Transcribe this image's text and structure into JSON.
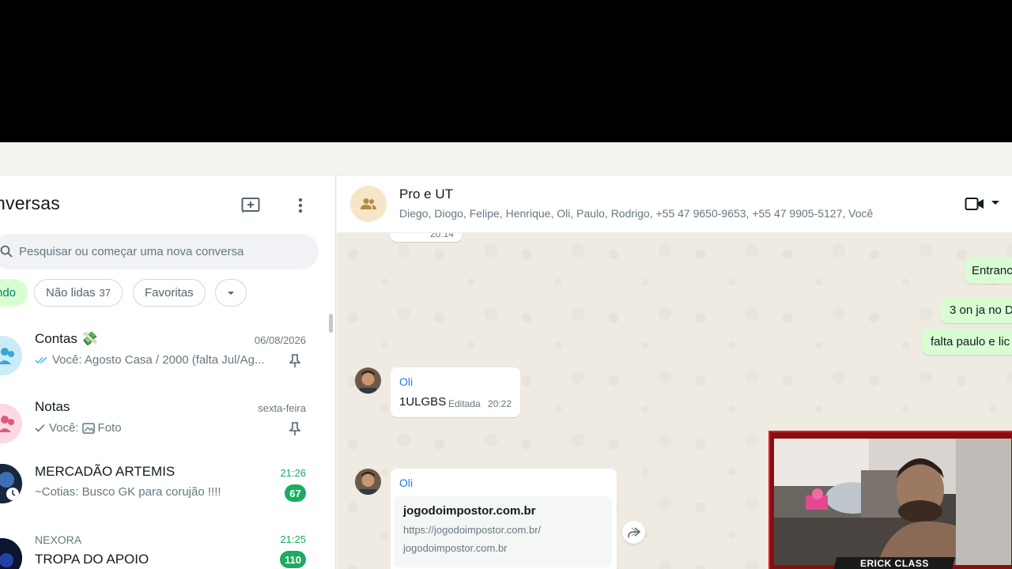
{
  "left_panel": {
    "title": "nversas",
    "search_placeholder": "Pesquisar ou começar uma nova conversa",
    "filters": [
      {
        "label": "ndo",
        "active": true
      },
      {
        "label": "Não lidas",
        "count": "37"
      },
      {
        "label": "Favoritas"
      }
    ],
    "chats": [
      {
        "name": "Contas 💸",
        "time": "06/08/2026",
        "preview": "Você: Agosto Casa / 2000 (falta Jul/Ag...",
        "pinned": true
      },
      {
        "name": "Notas",
        "time": "sexta-feira",
        "preview_prefix": "Você:",
        "preview": "Foto",
        "pinned": true
      },
      {
        "name": "MERCADÃO ARTEMIS",
        "time": "21:26",
        "preview": "~Cotias: Busco GK para corujão !!!!",
        "unread": "67"
      },
      {
        "label": "NEXORA",
        "name": "TROPA DO APOIO",
        "time": "21:25",
        "unread": "110"
      }
    ]
  },
  "conversation": {
    "group_name": "Pro e UT",
    "members": "Diego, Diogo, Felipe, Henrique, Oli, Paulo, Rodrigo, +55 47 9650-9653, +55 47 9905-5127, Você",
    "messages": [
      {
        "time": "20:14"
      },
      {
        "text": "Entranc"
      },
      {
        "text": "3 on ja no D"
      },
      {
        "text": "falta paulo e lic"
      },
      {
        "sender": "Oli",
        "text": "1ULGBS",
        "edited": "Editada",
        "time": "20:22"
      },
      {
        "sender": "Oli",
        "link_title": "jogodoimpostor.com.br",
        "link_url": "https://jogodoimpostor.com.br/",
        "link_domain": "jogodoimpostor.com.br"
      }
    ]
  },
  "webcam": {
    "label": "ERICK CLASS"
  },
  "colors": {
    "accent_green": "#1daa61",
    "chip_active_bg": "#d9fdd3",
    "outgoing_bubble": "#d9fdd3",
    "sender_blue": "#1f7aec",
    "webcam_red": "#e01b22"
  }
}
